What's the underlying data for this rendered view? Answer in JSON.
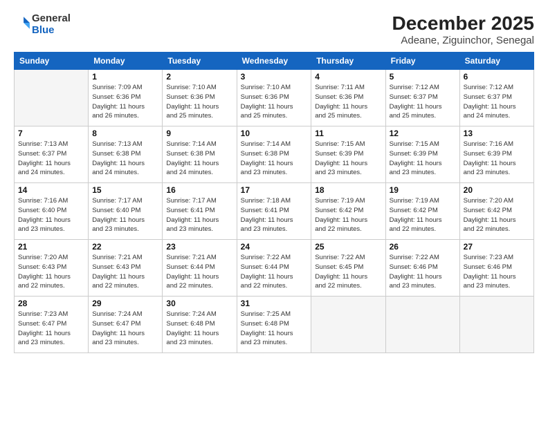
{
  "header": {
    "logo_line1": "General",
    "logo_line2": "Blue",
    "title": "December 2025",
    "subtitle": "Adeane, Ziguinchor, Senegal"
  },
  "columns": [
    "Sunday",
    "Monday",
    "Tuesday",
    "Wednesday",
    "Thursday",
    "Friday",
    "Saturday"
  ],
  "weeks": [
    [
      {
        "day": "",
        "info": ""
      },
      {
        "day": "1",
        "info": "Sunrise: 7:09 AM\nSunset: 6:36 PM\nDaylight: 11 hours\nand 26 minutes."
      },
      {
        "day": "2",
        "info": "Sunrise: 7:10 AM\nSunset: 6:36 PM\nDaylight: 11 hours\nand 25 minutes."
      },
      {
        "day": "3",
        "info": "Sunrise: 7:10 AM\nSunset: 6:36 PM\nDaylight: 11 hours\nand 25 minutes."
      },
      {
        "day": "4",
        "info": "Sunrise: 7:11 AM\nSunset: 6:36 PM\nDaylight: 11 hours\nand 25 minutes."
      },
      {
        "day": "5",
        "info": "Sunrise: 7:12 AM\nSunset: 6:37 PM\nDaylight: 11 hours\nand 25 minutes."
      },
      {
        "day": "6",
        "info": "Sunrise: 7:12 AM\nSunset: 6:37 PM\nDaylight: 11 hours\nand 24 minutes."
      }
    ],
    [
      {
        "day": "7",
        "info": "Sunrise: 7:13 AM\nSunset: 6:37 PM\nDaylight: 11 hours\nand 24 minutes."
      },
      {
        "day": "8",
        "info": "Sunrise: 7:13 AM\nSunset: 6:38 PM\nDaylight: 11 hours\nand 24 minutes."
      },
      {
        "day": "9",
        "info": "Sunrise: 7:14 AM\nSunset: 6:38 PM\nDaylight: 11 hours\nand 24 minutes."
      },
      {
        "day": "10",
        "info": "Sunrise: 7:14 AM\nSunset: 6:38 PM\nDaylight: 11 hours\nand 23 minutes."
      },
      {
        "day": "11",
        "info": "Sunrise: 7:15 AM\nSunset: 6:39 PM\nDaylight: 11 hours\nand 23 minutes."
      },
      {
        "day": "12",
        "info": "Sunrise: 7:15 AM\nSunset: 6:39 PM\nDaylight: 11 hours\nand 23 minutes."
      },
      {
        "day": "13",
        "info": "Sunrise: 7:16 AM\nSunset: 6:39 PM\nDaylight: 11 hours\nand 23 minutes."
      }
    ],
    [
      {
        "day": "14",
        "info": "Sunrise: 7:16 AM\nSunset: 6:40 PM\nDaylight: 11 hours\nand 23 minutes."
      },
      {
        "day": "15",
        "info": "Sunrise: 7:17 AM\nSunset: 6:40 PM\nDaylight: 11 hours\nand 23 minutes."
      },
      {
        "day": "16",
        "info": "Sunrise: 7:17 AM\nSunset: 6:41 PM\nDaylight: 11 hours\nand 23 minutes."
      },
      {
        "day": "17",
        "info": "Sunrise: 7:18 AM\nSunset: 6:41 PM\nDaylight: 11 hours\nand 23 minutes."
      },
      {
        "day": "18",
        "info": "Sunrise: 7:19 AM\nSunset: 6:42 PM\nDaylight: 11 hours\nand 22 minutes."
      },
      {
        "day": "19",
        "info": "Sunrise: 7:19 AM\nSunset: 6:42 PM\nDaylight: 11 hours\nand 22 minutes."
      },
      {
        "day": "20",
        "info": "Sunrise: 7:20 AM\nSunset: 6:42 PM\nDaylight: 11 hours\nand 22 minutes."
      }
    ],
    [
      {
        "day": "21",
        "info": "Sunrise: 7:20 AM\nSunset: 6:43 PM\nDaylight: 11 hours\nand 22 minutes."
      },
      {
        "day": "22",
        "info": "Sunrise: 7:21 AM\nSunset: 6:43 PM\nDaylight: 11 hours\nand 22 minutes."
      },
      {
        "day": "23",
        "info": "Sunrise: 7:21 AM\nSunset: 6:44 PM\nDaylight: 11 hours\nand 22 minutes."
      },
      {
        "day": "24",
        "info": "Sunrise: 7:22 AM\nSunset: 6:44 PM\nDaylight: 11 hours\nand 22 minutes."
      },
      {
        "day": "25",
        "info": "Sunrise: 7:22 AM\nSunset: 6:45 PM\nDaylight: 11 hours\nand 22 minutes."
      },
      {
        "day": "26",
        "info": "Sunrise: 7:22 AM\nSunset: 6:46 PM\nDaylight: 11 hours\nand 23 minutes."
      },
      {
        "day": "27",
        "info": "Sunrise: 7:23 AM\nSunset: 6:46 PM\nDaylight: 11 hours\nand 23 minutes."
      }
    ],
    [
      {
        "day": "28",
        "info": "Sunrise: 7:23 AM\nSunset: 6:47 PM\nDaylight: 11 hours\nand 23 minutes."
      },
      {
        "day": "29",
        "info": "Sunrise: 7:24 AM\nSunset: 6:47 PM\nDaylight: 11 hours\nand 23 minutes."
      },
      {
        "day": "30",
        "info": "Sunrise: 7:24 AM\nSunset: 6:48 PM\nDaylight: 11 hours\nand 23 minutes."
      },
      {
        "day": "31",
        "info": "Sunrise: 7:25 AM\nSunset: 6:48 PM\nDaylight: 11 hours\nand 23 minutes."
      },
      {
        "day": "",
        "info": ""
      },
      {
        "day": "",
        "info": ""
      },
      {
        "day": "",
        "info": ""
      }
    ]
  ]
}
